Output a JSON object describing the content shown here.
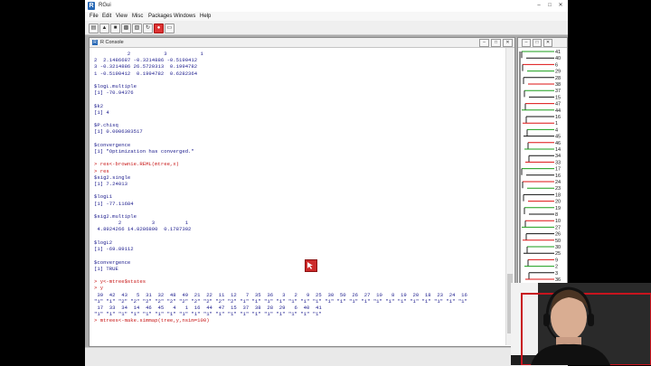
{
  "app": {
    "title": "RGui"
  },
  "menu": [
    "File",
    "Edit",
    "View",
    "Misc",
    "Packages",
    "Windows",
    "Help"
  ],
  "toolbar": {
    "icons": [
      "open-script-icon",
      "load-workspace-icon",
      "save-workspace-icon",
      "copy-icon",
      "paste-icon",
      "copy-paste-icon",
      "stop-icon",
      "print-icon"
    ]
  },
  "console": {
    "title": "R Console",
    "lines": [
      {
        "kind": "out",
        "text": "           2           3           1"
      },
      {
        "kind": "out",
        "text": "2  2.1486687 -0.3214886 -0.5190412"
      },
      {
        "kind": "out",
        "text": "3 -0.3214886 26.5720313  0.1994782"
      },
      {
        "kind": "out",
        "text": "1 -0.5190412  0.1994782  0.6282364"
      },
      {
        "kind": "out",
        "text": ""
      },
      {
        "kind": "out",
        "text": "$logL.multiple"
      },
      {
        "kind": "out",
        "text": "[1] -70.94376"
      },
      {
        "kind": "out",
        "text": ""
      },
      {
        "kind": "out",
        "text": "$k2"
      },
      {
        "kind": "out",
        "text": "[1] 4"
      },
      {
        "kind": "out",
        "text": ""
      },
      {
        "kind": "out",
        "text": "$P.chisq"
      },
      {
        "kind": "out",
        "text": "[1] 0.0006303517"
      },
      {
        "kind": "out",
        "text": ""
      },
      {
        "kind": "out",
        "text": "$convergence"
      },
      {
        "kind": "out",
        "text": "[1] \"Optimization has converged.\""
      },
      {
        "kind": "out",
        "text": ""
      },
      {
        "kind": "cmd",
        "text": "> res<-brownie.REML(mtree,x)"
      },
      {
        "kind": "cmd",
        "text": "> res"
      },
      {
        "kind": "out",
        "text": "$sig2.single"
      },
      {
        "kind": "out",
        "text": "[1] 7.24013"
      },
      {
        "kind": "out",
        "text": ""
      },
      {
        "kind": "out",
        "text": "$logL1"
      },
      {
        "kind": "out",
        "text": "[1] -77.11684"
      },
      {
        "kind": "out",
        "text": ""
      },
      {
        "kind": "out",
        "text": "$sig2.multiple"
      },
      {
        "kind": "out",
        "text": "        2          3          1"
      },
      {
        "kind": "out",
        "text": " 4.8924266 14.8286800  0.1787302"
      },
      {
        "kind": "out",
        "text": ""
      },
      {
        "kind": "out",
        "text": "$logL2"
      },
      {
        "kind": "out",
        "text": "[1] -69.89112"
      },
      {
        "kind": "out",
        "text": ""
      },
      {
        "kind": "out",
        "text": "$convergence"
      },
      {
        "kind": "out",
        "text": "[1] TRUE"
      },
      {
        "kind": "out",
        "text": ""
      },
      {
        "kind": "cmd",
        "text": "> y<-mtree$states"
      },
      {
        "kind": "cmd",
        "text": "> y"
      },
      {
        "kind": "out",
        "text": " 39  42  43   5  31  32  48  49  21  22  11  12   7  35  36   3   2   9  25  30  50  26  27  10   8  19  20  18  23  24  16"
      },
      {
        "kind": "out",
        "text": "\"1\" \"1\" \"2\" \"2\" \"2\" \"2\" \"2\" \"2\" \"2\" \"2\" \"2\" \"2\" \"1\" \"1\" \"1\" \"1\" \"1\" \"1\" \"1\" \"1\" \"1\" \"1\" \"1\" \"1\" \"1\" \"1\" \"1\" \"1\" \"1\" \"1\" \"1\""
      },
      {
        "kind": "out",
        "text": " 17  33  34  14  46  45   4   1  16  44  47  15  37  38  28  29   6  40  41"
      },
      {
        "kind": "out",
        "text": "\"1\" \"1\" \"1\" \"1\" \"1\" \"1\" \"1\" \"1\" \"1\" \"1\" \"1\" \"1\" \"1\" \"1\" \"1\" \"1\" \"1\" \"1\" \"1\""
      },
      {
        "kind": "cmd",
        "text": "> mtrees<-make.simmap(tree,y,nsim=100)"
      }
    ]
  },
  "graphics": {
    "tip_labels": [
      "41",
      "40",
      "6",
      "29",
      "28",
      "38",
      "37",
      "15",
      "47",
      "44",
      "16",
      "1",
      "4",
      "45",
      "46",
      "14",
      "34",
      "33",
      "17",
      "16",
      "24",
      "23",
      "18",
      "20",
      "19",
      "8",
      "10",
      "27",
      "26",
      "50",
      "30",
      "25",
      "9",
      "2",
      "3",
      "36",
      "35",
      "7",
      "12",
      "11",
      "22",
      "21"
    ],
    "colors": {
      "state1": "#d11",
      "state2": "#111",
      "state3": "#1a9e1a"
    }
  }
}
